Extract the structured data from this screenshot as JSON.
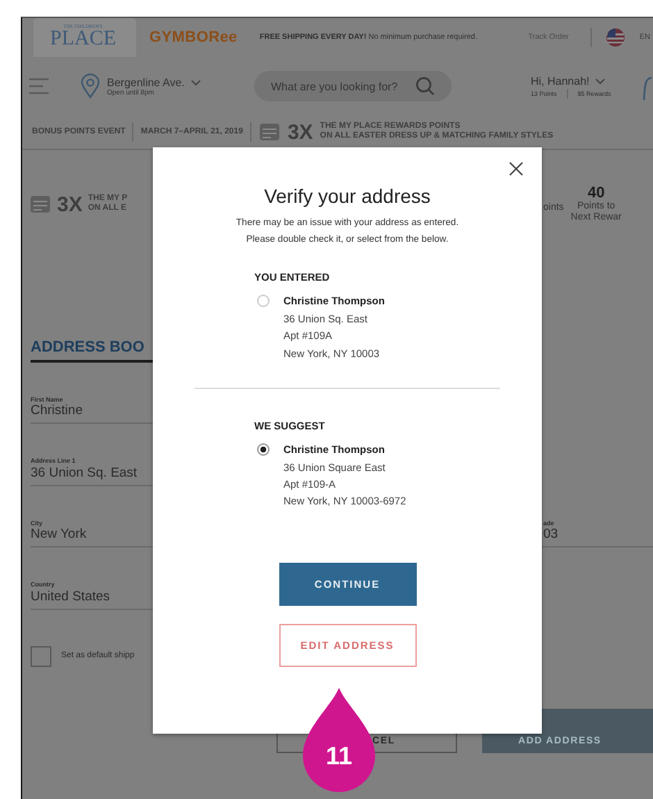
{
  "header": {
    "logo_small": "THE CHILDREN'S",
    "logo": "PLACE",
    "brand": "GYMBORee",
    "notice": "**FREE SHIPPING EVERY DAY!** No minimum purchase required.",
    "track_order": "Track Order",
    "language": "EN"
  },
  "nav": {
    "store": "Bergenline Ave.",
    "hours": "Open until 8pm",
    "search": {
      "placeholder": "What are you looking for?"
    },
    "greeting": "Hi, Hannah!",
    "points": "13 Points",
    "rewards": "$5 Rewards"
  },
  "promo": {
    "event": "BONUS POINTS EVENT",
    "dates": "MARCH 7–APRIL 21, 2019",
    "multiplier": "3X",
    "lines": [
      "THE MY PLACE REWARDS POINTS",
      "ON ALL EASTER DRESS UP & MATCHING FAMILY STYLES"
    ]
  },
  "rewards_banner": {
    "multiplier": "3X",
    "lines": [
      "THE MY P",
      "ON ALL E"
    ],
    "stat_label": "oints",
    "next": {
      "value": "40",
      "lines": [
        "Points to",
        "Next Rewar"
      ]
    }
  },
  "address_book": {
    "heading": "ADDRESS BOO",
    "rows": [
      {
        "label": "First Name",
        "value": "Christine"
      },
      {
        "label": "Address Line 1",
        "value": "36 Union Sq. East"
      },
      {
        "label": "City",
        "value": "New York",
        "right_label": "ade",
        "right_value": "03"
      },
      {
        "label": "Country",
        "value": "United States"
      }
    ],
    "default_shipping": {
      "label": "Set as default shipp",
      "checked": false
    },
    "cancel": "CEL",
    "add": "ADD ADDRESS"
  },
  "modal": {
    "title": "Verify your address",
    "description": [
      "There may be an issue with your address as entered.",
      "Please double check it, or select from the below."
    ],
    "sections": [
      {
        "heading": "YOU ENTERED",
        "options": [
          {
            "selected": false,
            "name": "Christine Thompson",
            "lines": [
              "36 Union Sq. East",
              "Apt #109A",
              "New York, NY 10003"
            ]
          }
        ]
      },
      {
        "heading": "WE SUGGEST",
        "options": [
          {
            "selected": true,
            "name": "Christine Thompson",
            "lines": [
              "36 Union Square East",
              "Apt #109-A",
              "New York, NY 10003-6972"
            ]
          }
        ]
      }
    ],
    "buttons": [
      {
        "kind": "primary",
        "label": "CONTINUE"
      },
      {
        "kind": "secondary",
        "label": "EDIT ADDRESS"
      }
    ]
  },
  "callout": {
    "label": "11"
  }
}
